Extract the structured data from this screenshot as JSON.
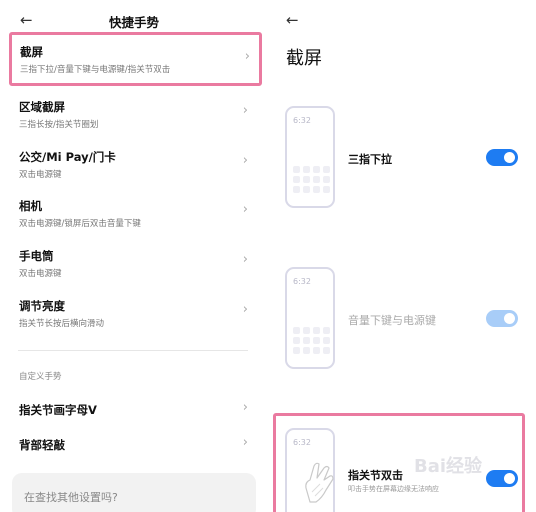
{
  "left": {
    "title": "快捷手势",
    "items": [
      {
        "title": "截屏",
        "sub": "三指下拉/音量下键与电源键/指关节双击"
      },
      {
        "title": "区域截屏",
        "sub": "三指长按/指关节圈划"
      },
      {
        "title": "公交/Mi Pay/门卡",
        "sub": "双击电源键"
      },
      {
        "title": "相机",
        "sub": "双击电源键/锁屏后双击音量下键"
      },
      {
        "title": "手电筒",
        "sub": "双击电源键"
      },
      {
        "title": "调节亮度",
        "sub": "指关节长按后横向滑动"
      }
    ],
    "section_label": "自定义手势",
    "custom_items": [
      {
        "title": "指关节画字母V"
      },
      {
        "title": "背部轻敲"
      }
    ],
    "search_placeholder": "在查找其他设置吗?"
  },
  "right": {
    "title": "截屏",
    "options": [
      {
        "phone_time": "6:32",
        "label": "三指下拉",
        "sub": "",
        "enabled": true,
        "disabled_style": false
      },
      {
        "phone_time": "6:32",
        "label": "音量下键与电源键",
        "sub": "",
        "enabled": true,
        "disabled_style": true
      },
      {
        "phone_time": "6:32",
        "label": "指关节双击",
        "sub": "叩击手势在屏幕边缘无法响应",
        "enabled": true,
        "disabled_style": false
      }
    ],
    "watermark": "Bai经验"
  },
  "colors": {
    "accent": "#1e7cf2",
    "highlight": "#ea7aa0"
  }
}
